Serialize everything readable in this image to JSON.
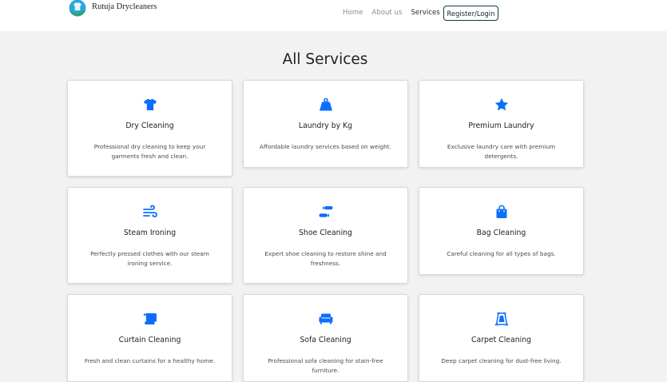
{
  "brand": {
    "name": "Rutuja Drycleaners"
  },
  "nav": {
    "links": [
      "Home",
      "About us",
      "Services"
    ],
    "login_label": "Register/Login"
  },
  "page": {
    "title": "All Services"
  },
  "services": [
    {
      "icon": "tshirt-icon",
      "title": "Dry Cleaning",
      "desc": "Professional dry cleaning to keep your garments fresh and clean."
    },
    {
      "icon": "weight-icon",
      "title": "Laundry by Kg",
      "desc": "Affordable laundry services based on weight."
    },
    {
      "icon": "star-icon",
      "title": "Premium Laundry",
      "desc": "Exclusive laundry care with premium detergents."
    },
    {
      "icon": "wind-icon",
      "title": "Steam Ironing",
      "desc": "Perfectly pressed clothes with our steam ironing service."
    },
    {
      "icon": "shoe-prints-icon",
      "title": "Shoe Cleaning",
      "desc": "Expert shoe cleaning to restore shine and freshness."
    },
    {
      "icon": "shopping-bag-icon",
      "title": "Bag Cleaning",
      "desc": "Careful cleaning for all types of bags."
    },
    {
      "icon": "scroll-icon",
      "title": "Curtain Cleaning",
      "desc": "Fresh and clean curtains for a healthy home."
    },
    {
      "icon": "couch-icon",
      "title": "Sofa Cleaning",
      "desc": "Professional sofa cleaning for stain-free furniture."
    },
    {
      "icon": "rug-icon",
      "title": "Carpet Cleaning",
      "desc": "Deep carpet cleaning for dust-free living."
    }
  ],
  "colors": {
    "accent": "#0d6efd",
    "login_border": "#0b3b4a",
    "background": "#f2f2f2"
  }
}
